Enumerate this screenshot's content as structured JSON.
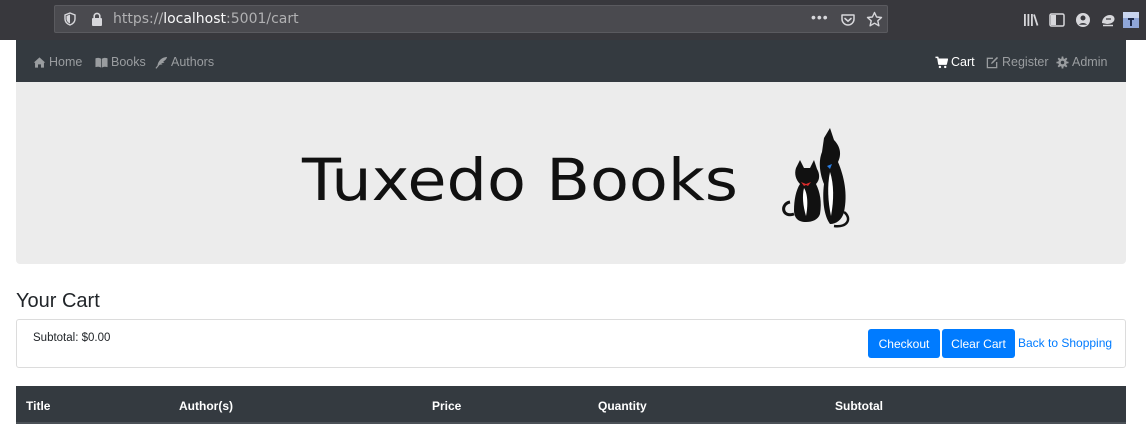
{
  "browser": {
    "url_scheme": "https://",
    "url_host": "localhost",
    "url_rest": ":5001/cart",
    "page_actions_label": "•••"
  },
  "nav": {
    "left": [
      {
        "label": "Home",
        "icon": "home-icon"
      },
      {
        "label": "Books",
        "icon": "book-icon"
      },
      {
        "label": "Authors",
        "icon": "feather-icon"
      }
    ],
    "right": [
      {
        "label": "Cart",
        "icon": "cart-icon",
        "active": true
      },
      {
        "label": "Register",
        "icon": "edit-icon"
      },
      {
        "label": "Admin",
        "icon": "gear-icon"
      }
    ]
  },
  "hero": {
    "logo_text": "Tuxedo Books"
  },
  "cart": {
    "title": "Your Cart",
    "subtotal": "Subtotal: $0.00",
    "checkout_label": "Checkout",
    "clear_label": "Clear Cart",
    "back_label": "Back to Shopping"
  },
  "table": {
    "columns": [
      "Title",
      "Author(s)",
      "Price",
      "Quantity",
      "Subtotal"
    ]
  },
  "colors": {
    "navbar": "#343a40",
    "primary": "#007bff",
    "jumbotron": "#ececec"
  }
}
